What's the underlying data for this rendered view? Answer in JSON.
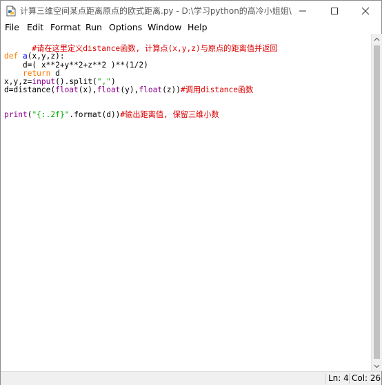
{
  "window": {
    "title": "计算三维空间某点距离原点的欧式距离.py - D:\\学习python的高冷小姐姐\\计..."
  },
  "menu": [
    "File",
    "Edit",
    "Format",
    "Run",
    "Options",
    "Window",
    "Help"
  ],
  "code": {
    "line1": {
      "comment": "#请在这里定义distance函数, 计算点(x,y,z)与原点的距离值并返回"
    },
    "line3": {
      "kw": "def",
      "name": "a",
      "rest": "(x,y,z):"
    },
    "line4": {
      "text": "    d=( x**2+y**2+z**2 )**(1/2)"
    },
    "line5": {
      "indent": "    ",
      "kw": "return",
      "rest": " d"
    },
    "line6": {
      "pre": "x,y,z=",
      "builtin": "input",
      "mid": "().split(",
      "str": "\",\"",
      "post": ")"
    },
    "line7": {
      "pre": "d=distance(",
      "b1": "float",
      "a1": "(x),",
      "b2": "float",
      "a2": "(y),",
      "b3": "float",
      "a3": "(z))",
      "comment": "#调用distance函数"
    },
    "line9": {
      "builtin": "print",
      "open": "(",
      "str": "\"{:.2f}\"",
      "mid": ".format(d))",
      "comment": "#输出距离值, 保留三维小数"
    }
  },
  "status": {
    "ln": "Ln: 4",
    "col": "Col: 26"
  },
  "colors": {
    "keyword": "#ff7700",
    "builtin": "#900090",
    "definition": "#0000ff",
    "string": "#00aa00",
    "comment": "#dd0000"
  }
}
